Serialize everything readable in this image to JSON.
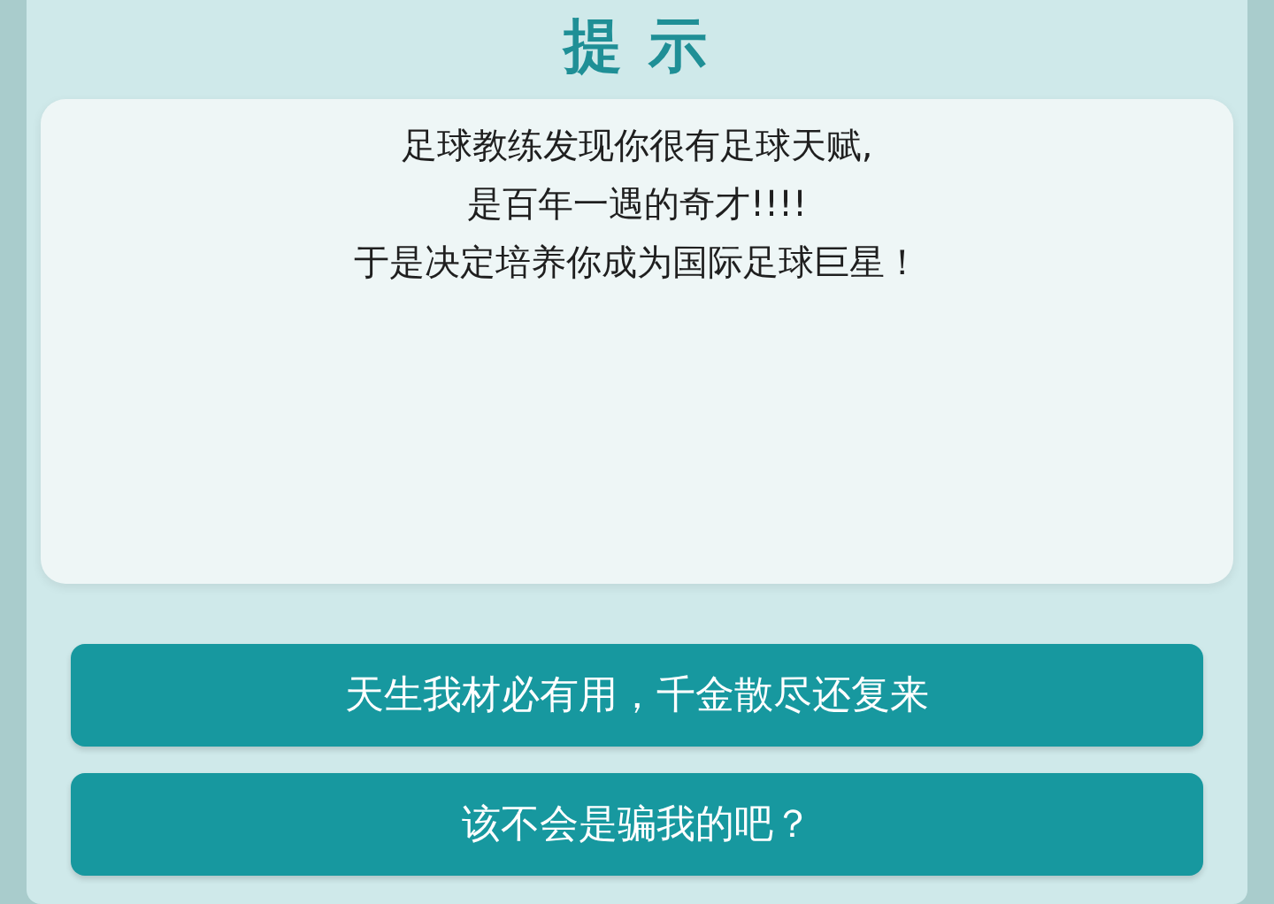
{
  "dialog": {
    "title": "提 示",
    "message": [
      "足球教练发现你很有足球天赋,",
      "是百年一遇的奇才!!!!",
      "于是决定培养你成为国际足球巨星！"
    ],
    "options": [
      {
        "label": "天生我材必有用，千金散尽还复来"
      },
      {
        "label": "该不会是骗我的吧？"
      }
    ]
  }
}
